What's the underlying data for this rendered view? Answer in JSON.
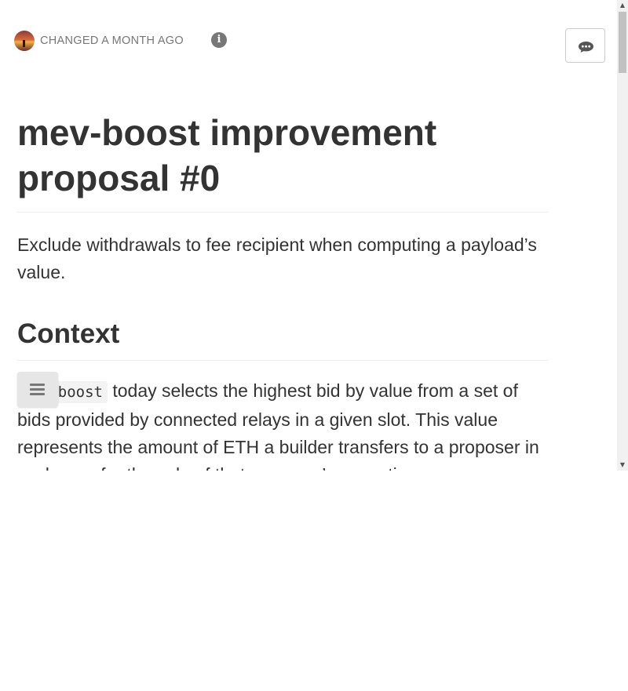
{
  "header": {
    "changed_text": "CHANGED A MONTH AGO",
    "avatar_icon": "avatar-sunset",
    "info_icon": "info-icon",
    "comment_icon": "comment-icon"
  },
  "document": {
    "title": "mev-boost improvement proposal #0",
    "lead": "Exclude withdrawals to fee recipient when computing a payload’s value.",
    "sections": [
      {
        "heading": "Context",
        "body_code": "mev-boost",
        "body_text": " today selects the highest bid by value from a set of bids provided by connected relays in a given slot. This value represents the amount of ETH a builder transfers to a proposer in exchange for the sale of that proposer’s execution"
      }
    ]
  },
  "toc_button": {
    "icon": "menu-icon"
  },
  "colors": {
    "text": "#333333",
    "muted": "#777777",
    "rule": "#eeeeee",
    "code_bg": "#f3f3f3"
  }
}
